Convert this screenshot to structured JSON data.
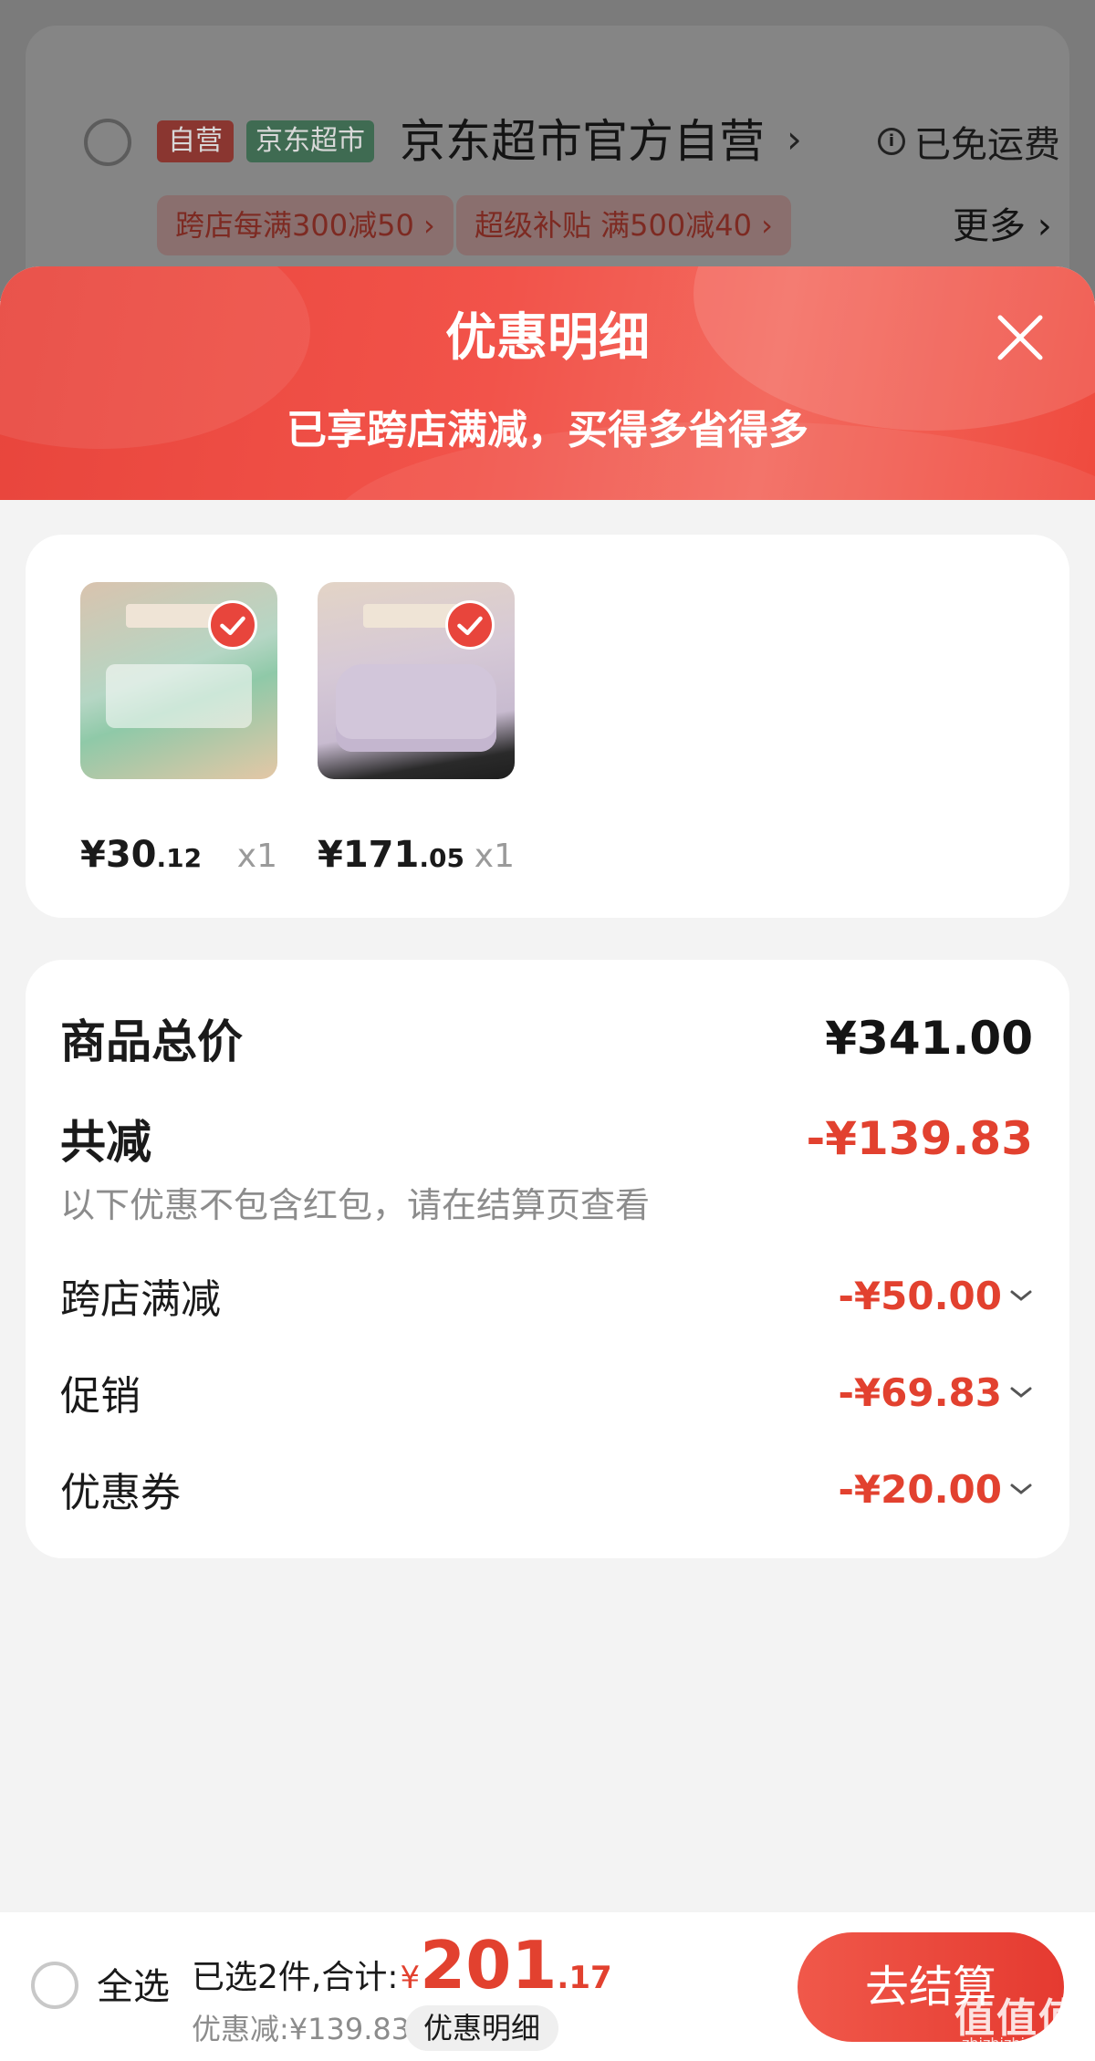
{
  "background_store": {
    "tag_ziying": "自营",
    "tag_jd": "京东超市",
    "store_name": "京东超市官方自营",
    "shipping": "已免运费",
    "promos": [
      "跨店每满300减50",
      "超级补贴 满500减40"
    ],
    "more_label": "更多"
  },
  "sheet": {
    "title": "优惠明细",
    "subtitle": "已享跨店满减，买得多省得多"
  },
  "products": [
    {
      "price_int": "¥30",
      "price_dec": ".12",
      "qty": "x1",
      "icon": "tissue-product-thumbnail"
    },
    {
      "price_int": "¥171",
      "price_dec": ".05",
      "qty": "x1",
      "icon": "blanket-product-thumbnail"
    }
  ],
  "totals": {
    "total_label": "商品总价",
    "total_amount": "¥341.00",
    "minus_label": "共减",
    "minus_amount": "-¥139.83",
    "note": "以下优惠不包含红包，请在结算页查看",
    "items": [
      {
        "label": "跨店满减",
        "amount": "-¥50.00"
      },
      {
        "label": "促销",
        "amount": "-¥69.83"
      },
      {
        "label": "优惠券",
        "amount": "-¥20.00"
      }
    ]
  },
  "bottom": {
    "select_all": "全选",
    "summary": "已选2件,合计:",
    "yen": "¥",
    "total_int": "201",
    "total_dec": ".17",
    "discount": "优惠减:¥139.83",
    "detail_chip": "优惠明细",
    "checkout": "去结算"
  },
  "watermark": {
    "text": "值值值",
    "sub": "zhizhizhi.com"
  },
  "colors": {
    "accent": "#e8453c",
    "price_red": "#e2412f"
  }
}
